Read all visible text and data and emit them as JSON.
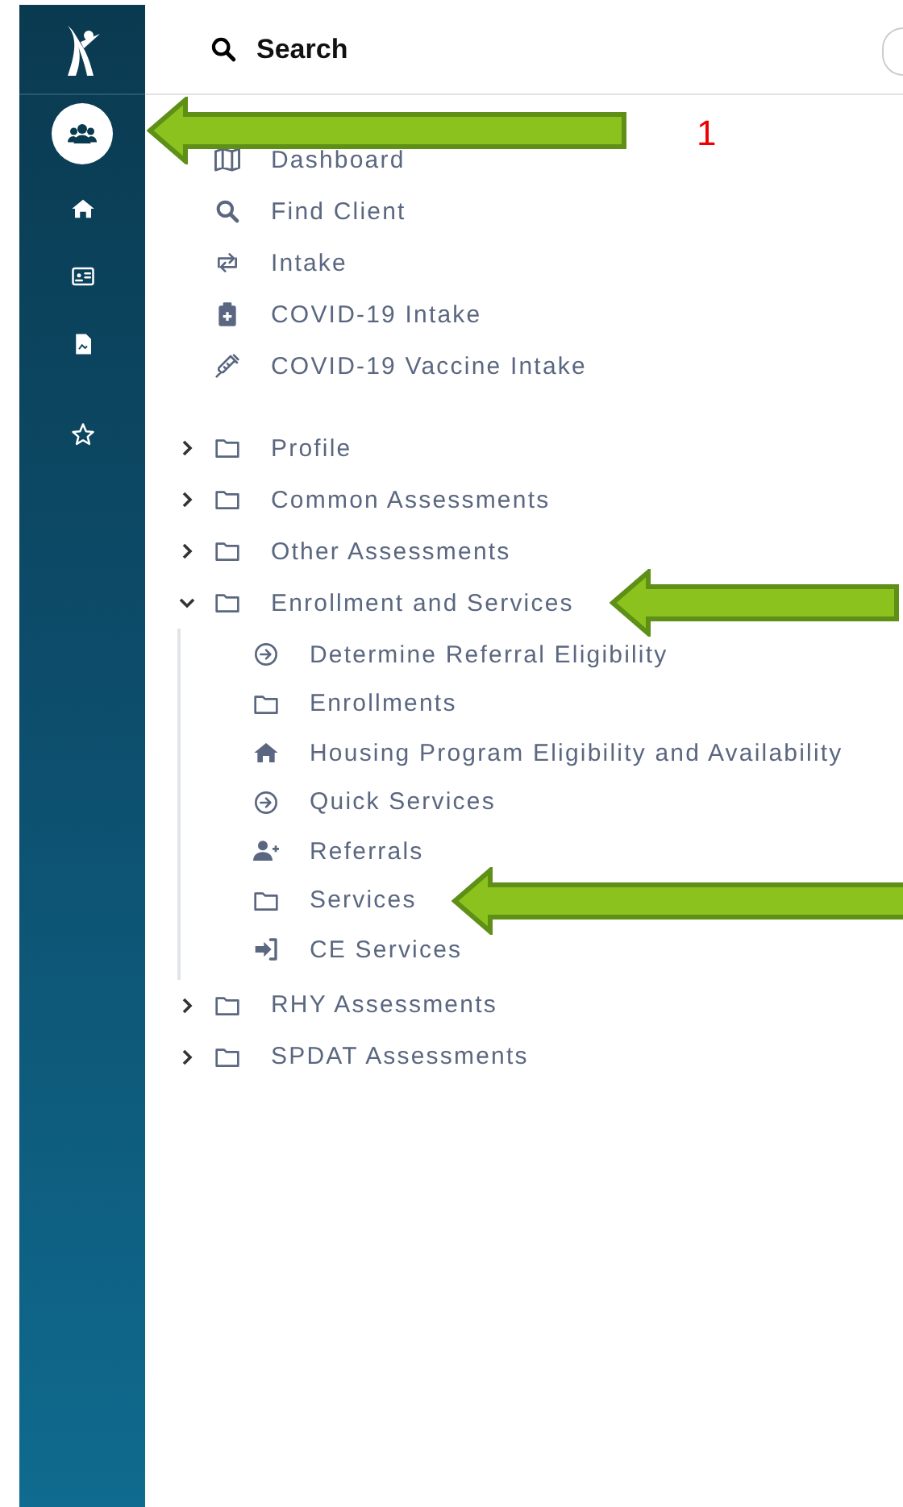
{
  "header": {
    "title": "Search"
  },
  "rail": [
    {
      "kind": "people",
      "selected": true,
      "callout": "1"
    },
    {
      "kind": "home",
      "selected": false
    },
    {
      "kind": "card",
      "selected": false
    },
    {
      "kind": "document",
      "selected": false
    },
    {
      "kind": "star",
      "selected": false
    }
  ],
  "quick_links": [
    {
      "label": "Dashboard",
      "kind": "map"
    },
    {
      "label": "Find Client",
      "kind": "search"
    },
    {
      "label": "Intake",
      "kind": "swap"
    },
    {
      "label": "COVID-19 Intake",
      "kind": "clipboard"
    },
    {
      "label": "COVID-19 Vaccine Intake",
      "kind": "syringe"
    }
  ],
  "folders": [
    {
      "label": "Profile",
      "expanded": false,
      "annotated": false
    },
    {
      "label": "Common Assessments",
      "expanded": false,
      "annotated": false
    },
    {
      "label": "Other Assessments",
      "expanded": false,
      "annotated": false
    },
    {
      "label": "Enrollment and Services",
      "expanded": true,
      "annotated": true,
      "children": [
        {
          "label": "Determine Referral Eligibility",
          "kind": "arrow-circle",
          "annotated": false
        },
        {
          "label": "Enrollments",
          "kind": "folder",
          "annotated": false
        },
        {
          "label": "Housing Program Eligibility and Availability",
          "kind": "home",
          "annotated": false
        },
        {
          "label": "Quick Services",
          "kind": "arrow-circle",
          "annotated": false
        },
        {
          "label": "Referrals",
          "kind": "user-plus",
          "annotated": false
        },
        {
          "label": "Services",
          "kind": "folder",
          "annotated": true
        },
        {
          "label": "CE Services",
          "kind": "sign-in",
          "annotated": false
        }
      ]
    },
    {
      "label": "RHY Assessments",
      "expanded": false,
      "annotated": false
    },
    {
      "label": "SPDAT Assessments",
      "expanded": false,
      "annotated": false
    }
  ]
}
